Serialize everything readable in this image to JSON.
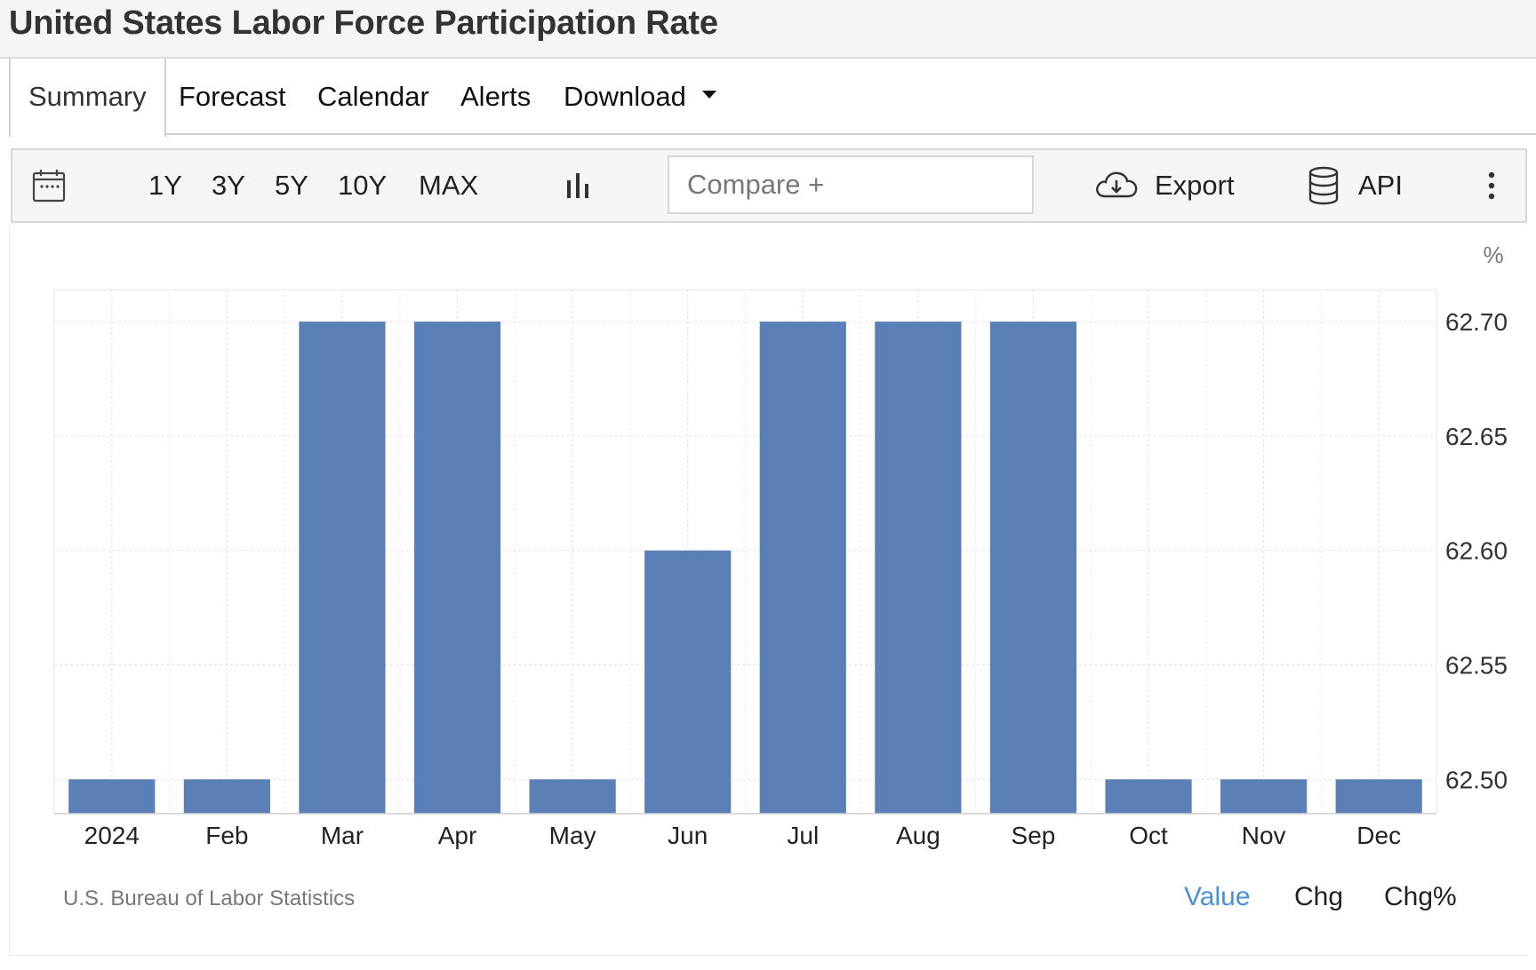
{
  "page": {
    "title": "United States Labor Force Participation Rate"
  },
  "tabs": [
    {
      "label": "Summary",
      "active": true
    },
    {
      "label": "Forecast"
    },
    {
      "label": "Calendar"
    },
    {
      "label": "Alerts"
    },
    {
      "label": "Download"
    }
  ],
  "toolbar": {
    "ranges": [
      "1Y",
      "3Y",
      "5Y",
      "10Y",
      "MAX"
    ],
    "compare_placeholder": "Compare +",
    "export_label": "Export",
    "api_label": "API",
    "icons": [
      "calendar-icon",
      "bar-chart-icon",
      "cloud-download-icon",
      "database-icon",
      "more-vertical-icon"
    ]
  },
  "chart_data": {
    "type": "bar",
    "categories": [
      "2024",
      "Feb",
      "Mar",
      "Apr",
      "May",
      "Jun",
      "Jul",
      "Aug",
      "Sep",
      "Oct",
      "Nov",
      "Dec"
    ],
    "values": [
      62.5,
      62.5,
      62.7,
      62.7,
      62.5,
      62.6,
      62.7,
      62.7,
      62.7,
      62.5,
      62.5,
      62.5
    ],
    "unit": "%",
    "y_ticks": [
      "62.70",
      "62.65",
      "62.60",
      "62.55",
      "62.50"
    ],
    "ylim": [
      62.485,
      62.714
    ],
    "y_axis_side": "right",
    "grid": true,
    "bar_color": "#5b80b8"
  },
  "footer": {
    "source": "U.S. Bureau of Labor Statistics",
    "modes": [
      {
        "label": "Value",
        "active": true
      },
      {
        "label": "Chg"
      },
      {
        "label": "Chg%"
      }
    ]
  }
}
